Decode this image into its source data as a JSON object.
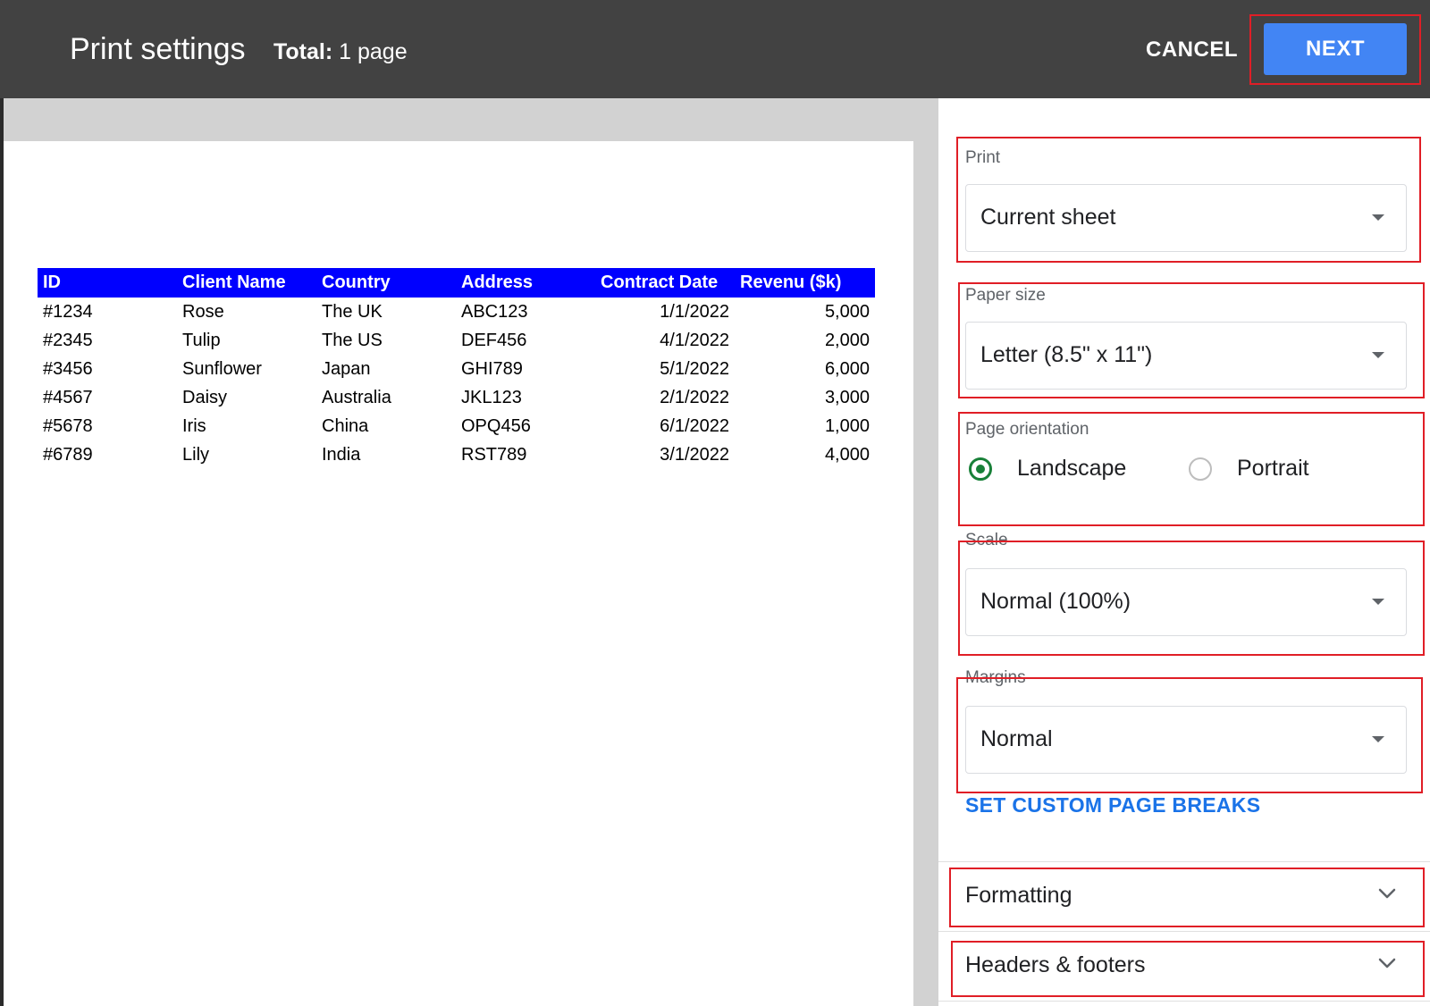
{
  "header": {
    "title": "Print settings",
    "total_label": "Total:",
    "total_value": "1 page",
    "cancel_label": "CANCEL",
    "next_label": "NEXT"
  },
  "sheet": {
    "columns": [
      "ID",
      "Client Name",
      "Country",
      "Address",
      "Contract Date",
      "Revenu ($k)"
    ],
    "rows": [
      [
        "#1234",
        "Rose",
        "The UK",
        "ABC123",
        "1/1/2022",
        "5,000"
      ],
      [
        "#2345",
        "Tulip",
        "The US",
        "DEF456",
        "4/1/2022",
        "2,000"
      ],
      [
        "#3456",
        "Sunflower",
        "Japan",
        "GHI789",
        "5/1/2022",
        "6,000"
      ],
      [
        "#4567",
        "Daisy",
        "Australia",
        "JKL123",
        "2/1/2022",
        "3,000"
      ],
      [
        "#5678",
        "Iris",
        "China",
        "OPQ456",
        "6/1/2022",
        "1,000"
      ],
      [
        "#6789",
        "Lily",
        "India",
        "RST789",
        "3/1/2022",
        "4,000"
      ]
    ],
    "header_color": "#0000ff"
  },
  "settings": {
    "print": {
      "label": "Print",
      "value": "Current sheet"
    },
    "paper_size": {
      "label": "Paper size",
      "value": "Letter (8.5\" x 11\")"
    },
    "orientation": {
      "label": "Page orientation",
      "options": [
        "Landscape",
        "Portrait"
      ],
      "selected": "Landscape"
    },
    "scale": {
      "label": "Scale",
      "value": "Normal (100%)"
    },
    "margins": {
      "label": "Margins",
      "value": "Normal"
    },
    "custom_breaks_label": "SET CUSTOM PAGE BREAKS",
    "formatting_label": "Formatting",
    "headers_footers_label": "Headers & footers"
  },
  "colors": {
    "header_bg": "#424242",
    "next_button": "#4285f4",
    "link": "#1a73e8",
    "radio_selected": "#188038",
    "highlight_box": "#e01e26"
  },
  "icons": [
    "caret-down-icon",
    "chevron-down-icon",
    "radio-checked-icon",
    "radio-unchecked-icon"
  ]
}
